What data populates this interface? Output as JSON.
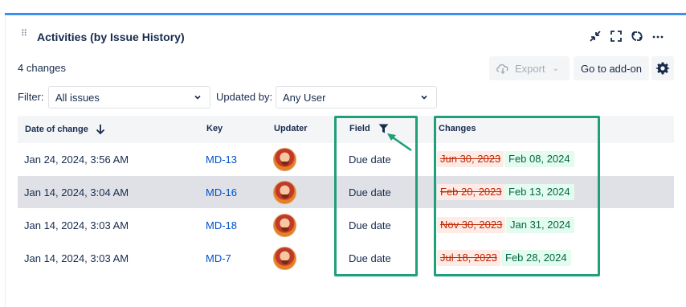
{
  "panel": {
    "title": "Activities (by Issue History)"
  },
  "header_icons": [
    "collapse-icon",
    "fullscreen-icon",
    "refresh-icon",
    "more-icon"
  ],
  "summary": {
    "changes_count": "4 changes"
  },
  "toolbar": {
    "export_label": "Export",
    "goto_label": "Go to add-on"
  },
  "filters": {
    "filter_label": "Filter:",
    "filter_value": "All issues",
    "updated_by_label": "Updated by:",
    "updated_by_value": "Any User"
  },
  "table": {
    "columns": {
      "date": "Date of change",
      "key": "Key",
      "updater": "Updater",
      "field": "Field",
      "changes": "Changes"
    },
    "rows": [
      {
        "date": "Jan 24, 2024, 3:56 AM",
        "key": "MD-13",
        "field": "Due date",
        "old": "Jun 30, 2023",
        "new": "Feb 08, 2024"
      },
      {
        "date": "Jan 14, 2024, 3:04 AM",
        "key": "MD-16",
        "field": "Due date",
        "old": "Feb 20, 2023",
        "new": "Feb 13, 2024"
      },
      {
        "date": "Jan 14, 2024, 3:03 AM",
        "key": "MD-18",
        "field": "Due date",
        "old": "Nov 30, 2023",
        "new": "Jan 31, 2024"
      },
      {
        "date": "Jan 14, 2024, 3:03 AM",
        "key": "MD-7",
        "field": "Due date",
        "old": "Jul 18, 2023",
        "new": "Feb 28, 2024"
      }
    ]
  },
  "colors": {
    "accent": "#3c8ff0",
    "highlight_box": "#1f9f7a"
  }
}
